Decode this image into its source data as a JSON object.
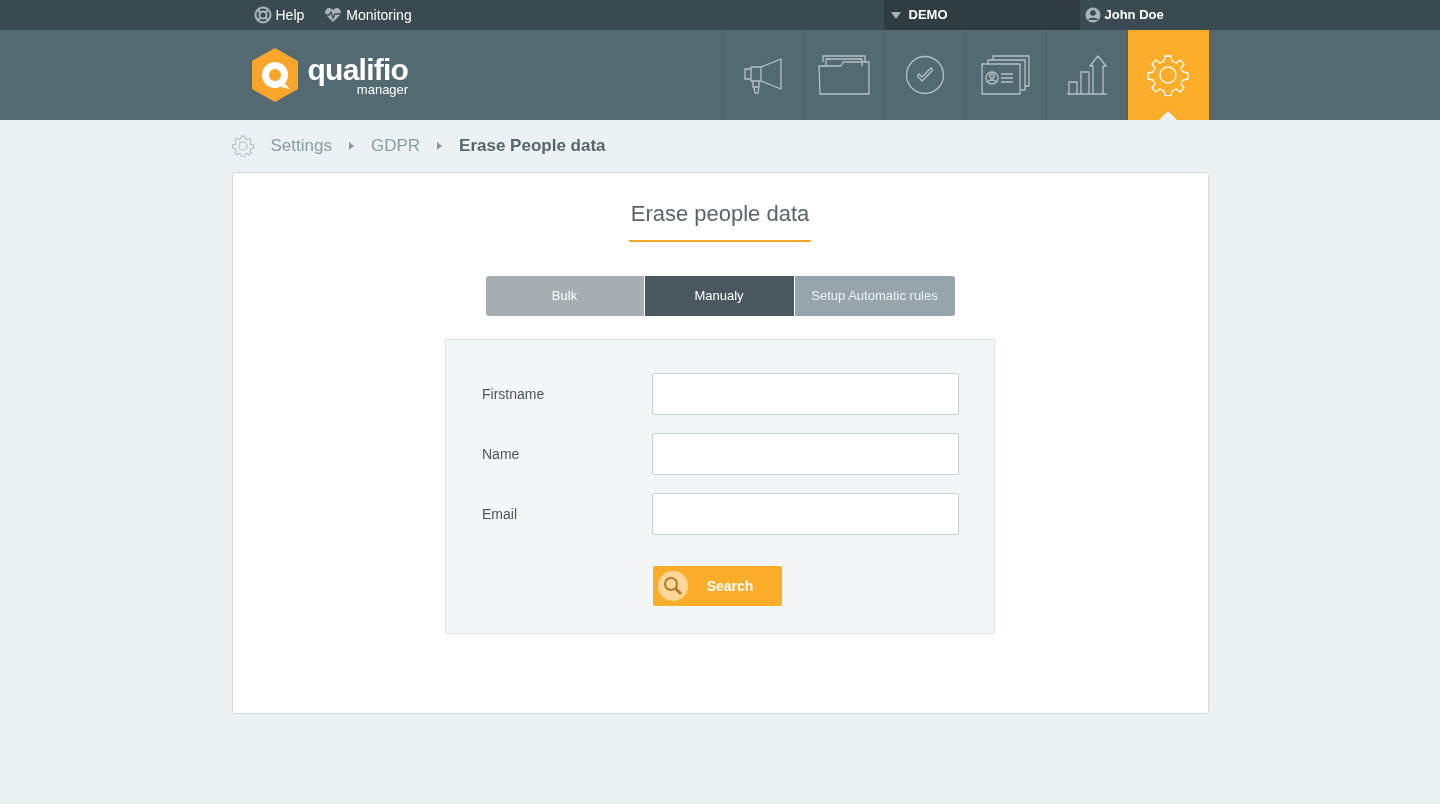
{
  "topbar": {
    "help": "Help",
    "monitoring": "Monitoring",
    "account": "DEMO",
    "user": "John Doe"
  },
  "logo": {
    "name": "qualifio",
    "sub": "manager"
  },
  "nav": [
    {
      "kind": "megaphone",
      "selected": false
    },
    {
      "kind": "folder",
      "selected": false
    },
    {
      "kind": "check",
      "selected": false
    },
    {
      "kind": "cards",
      "selected": false
    },
    {
      "kind": "chart",
      "selected": false
    },
    {
      "kind": "gear",
      "selected": true
    }
  ],
  "breadcrumb": [
    "Settings",
    "GDPR",
    "Erase People data"
  ],
  "title": "Erase people data",
  "tabs": [
    {
      "label": "Bulk",
      "selected": false
    },
    {
      "label": "Manualy",
      "selected": true
    },
    {
      "label": "Setup Automatic rules",
      "selected": false
    }
  ],
  "fields": [
    {
      "label": "Firstname"
    },
    {
      "label": "Name"
    },
    {
      "label": "Email"
    }
  ],
  "search_button": "Search"
}
